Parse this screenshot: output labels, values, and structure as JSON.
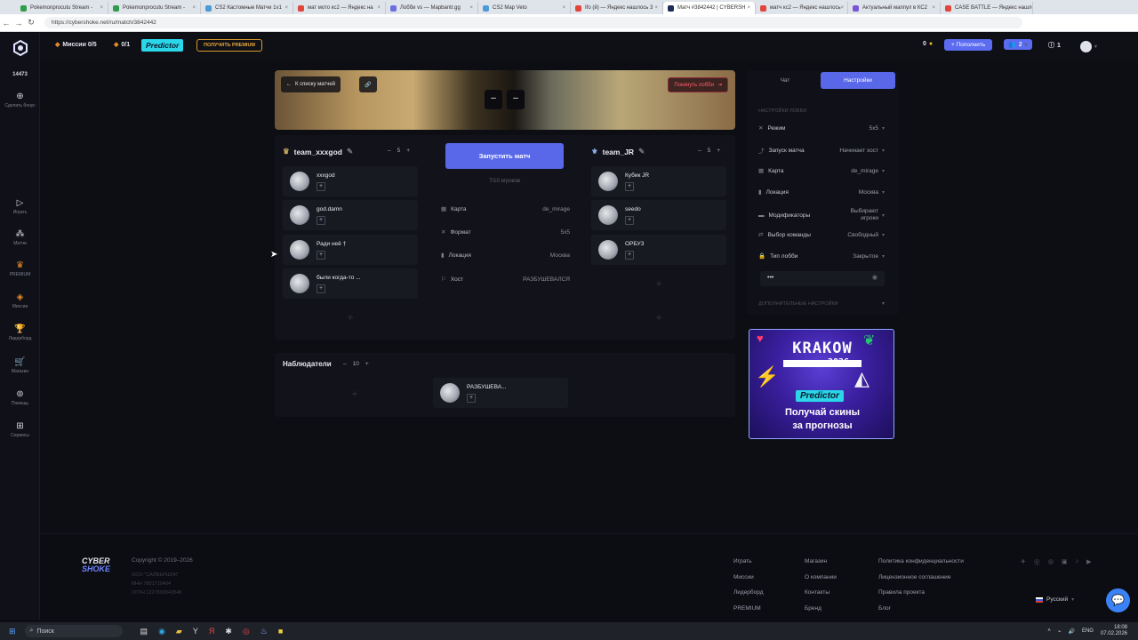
{
  "browser": {
    "tabs": [
      {
        "title": "Pokemonprocutu Stream - ",
        "color": "#2f9d4a",
        "active": false
      },
      {
        "title": "Pokemonprocutu Stream - ",
        "color": "#2f9d4a",
        "active": false
      },
      {
        "title": "CS2 Кастомные Матчи 1v1",
        "color": "#4d9bd6",
        "active": false
      },
      {
        "title": "мат мото кс2 — Яндекс на",
        "color": "#e0463c",
        "active": false
      },
      {
        "title": "Лобби vs — Mapbantr.gg",
        "color": "#6b6fe0",
        "active": false
      },
      {
        "title": "CS2 Map Veto",
        "color": "#4d9bd6",
        "active": false
      },
      {
        "title": "Ifo (й) — Яндекс нашлось 3",
        "color": "#e0463c",
        "active": false
      },
      {
        "title": "Матч #3842442 | CYBERSH",
        "color": "#1e2a5a",
        "active": true
      },
      {
        "title": "матч кс2 — Яндекс нашлось",
        "color": "#e0463c",
        "active": false
      },
      {
        "title": "Актуальный маппул в КС2",
        "color": "#7a55d8",
        "active": false
      },
      {
        "title": "CASE BATTLE — Яндекс нашлось",
        "color": "#e0463c",
        "active": false
      }
    ],
    "url": "https://cybershoke.net/ru/match/3842442"
  },
  "topbar": {
    "missions": "Миссии 0/5",
    "counter": "0/1",
    "predictor": "Predictor",
    "premium_btn": "ПОЛУЧИТЬ PREMIUM",
    "coins": "0",
    "topup": "+ Пополнить",
    "friends": "2",
    "notif": "1"
  },
  "leftnav": {
    "user_count": "14473",
    "items": [
      {
        "label": "Сделать бонус"
      },
      {
        "label": "Играть"
      },
      {
        "label": "Матчи"
      },
      {
        "label": "PREMIUM"
      },
      {
        "label": "Миссии"
      },
      {
        "label": "Лидерборд"
      },
      {
        "label": "Магазин"
      },
      {
        "label": "Помощь"
      },
      {
        "label": "Сервисы"
      }
    ]
  },
  "banner": {
    "back_btn": "К списку матчей",
    "leave_btn": "Покинуть лобби",
    "score_a": "–",
    "score_b": "–"
  },
  "team_a": {
    "name": "team_xxxgod",
    "size": "5",
    "players": [
      "xxxgod",
      "god.damn",
      "Ради неё †",
      "были когда-то ..."
    ]
  },
  "team_b": {
    "name": "team_JR",
    "size": "5",
    "players": [
      "Кубик JR",
      "seedo",
      "ОРБУЗ"
    ]
  },
  "center": {
    "start_btn": "Запустить матч",
    "players_count": "7/10 игроков",
    "info": [
      {
        "label": "Карта",
        "value": "de_mirage",
        "icon": "map-icon"
      },
      {
        "label": "Формат",
        "value": "5x5",
        "icon": "format-icon"
      },
      {
        "label": "Локация",
        "value": "Москва",
        "icon": "location-icon"
      },
      {
        "label": "Хост",
        "value": "РАЗБУШЕВАЛСЯ",
        "icon": "host-icon"
      }
    ]
  },
  "observers": {
    "title": "Наблюдатели",
    "size": "10",
    "players": [
      "РАЗБУШЕВА..."
    ]
  },
  "settings": {
    "tabs": [
      "Чат",
      "Настройки"
    ],
    "section": "НАСТРОЙКИ ЛОББИ",
    "rows": [
      {
        "label": "Режим",
        "value": "5x5"
      },
      {
        "label": "Запуск матча",
        "value": "Начинает хост"
      },
      {
        "label": "Карта",
        "value": "de_mirage"
      },
      {
        "label": "Локация",
        "value": "Москва"
      },
      {
        "label": "Модификаторы",
        "value": "Выбирают игроки"
      },
      {
        "label": "Выбор команды",
        "value": "Свободный"
      },
      {
        "label": "Тип лобби",
        "value": "Закрытое"
      }
    ],
    "password": "•••",
    "extra": "ДОПОЛНИТЕЛЬНЫЕ НАСТРОЙКИ"
  },
  "ad": {
    "line1": "KRAKOW",
    "line2": "2026",
    "brand": "Predictor",
    "text1": "Получай скины",
    "text2": "за прогнозы"
  },
  "footer": {
    "logo1": "CYBER",
    "logo2": "SHOKE",
    "copyright": "Copyright © 2019–2026",
    "company": "ООО \"САЙБЕРШОК\"",
    "inn": "ИНН 7801710404",
    "ogrn": "ОГРН 1227800042848",
    "col1": [
      "Играть",
      "Миссии",
      "Лидерборд",
      "PREMIUM"
    ],
    "col2": [
      "Магазин",
      "О компании",
      "Контакты",
      "Бренд"
    ],
    "col3": [
      "Политика конфиденциальности",
      "Лицензионное соглашение",
      "Правила проекта",
      "Блог"
    ],
    "language": "Русский"
  },
  "taskbar": {
    "search": "Поиск",
    "lang": "ENG",
    "time": "18:08",
    "date": "07.02.2026"
  }
}
